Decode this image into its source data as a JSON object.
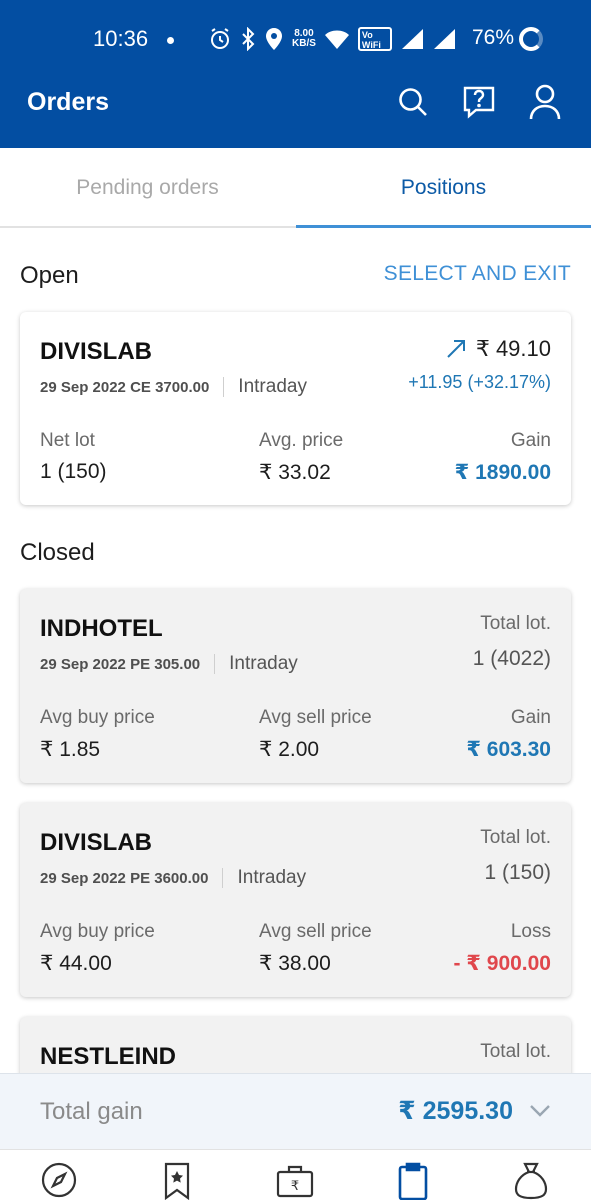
{
  "status_bar": {
    "time": "10:36",
    "speed_value": "8.00",
    "speed_unit": "KB/S",
    "volte_label": "Vo WiFi 1",
    "battery": "76%"
  },
  "app_bar": {
    "title": "Orders",
    "icons": [
      "search-icon",
      "help-icon",
      "profile-icon"
    ]
  },
  "tabs": {
    "pending": "Pending orders",
    "positions": "Positions",
    "active": "positions"
  },
  "open_section": {
    "title": "Open",
    "action": "SELECT AND EXIT",
    "position": {
      "symbol": "DIVISLAB",
      "contract": "29 Sep 2022 CE 3700.00",
      "type": "Intraday",
      "ltp": "₹ 49.10",
      "change": "+11.95 (+32.17%)",
      "labels": {
        "lot": "Net lot",
        "price": "Avg. price",
        "pnl": "Gain"
      },
      "values": {
        "lot": "1 (150)",
        "price": "₹ 33.02",
        "pnl": "₹ 1890.00"
      }
    }
  },
  "closed_section": {
    "title": "Closed",
    "positions": [
      {
        "symbol": "INDHOTEL",
        "contract": "29 Sep 2022 PE 305.00",
        "type": "Intraday",
        "total_lot_label": "Total lot.",
        "total_lot": "1 (4022)",
        "buy_label": "Avg buy price",
        "buy": "₹ 1.85",
        "sell_label": "Avg sell price",
        "sell": "₹ 2.00",
        "pnl_label": "Gain",
        "pnl": "₹ 603.30"
      },
      {
        "symbol": "DIVISLAB",
        "contract": "29 Sep 2022 PE 3600.00",
        "type": "Intraday",
        "total_lot_label": "Total lot.",
        "total_lot": "1 (150)",
        "buy_label": "Avg buy price",
        "buy": "₹ 44.00",
        "sell_label": "Avg sell price",
        "sell": "₹ 38.00",
        "pnl_label": "Loss",
        "pnl": "- ₹ 900.00"
      },
      {
        "symbol": "NESTLEIND",
        "total_lot_label": "Total lot."
      }
    ]
  },
  "total_bar": {
    "label": "Total gain",
    "value": "₹ 2595.30"
  },
  "bottom_nav": [
    "compass-icon",
    "watchlist-icon",
    "portfolio-icon",
    "orders-icon",
    "funds-icon"
  ],
  "colors": {
    "brand_blue": "#034ea2",
    "accent_blue": "#3f90d6",
    "gain": "#1f77b4",
    "loss": "#e0474c"
  }
}
